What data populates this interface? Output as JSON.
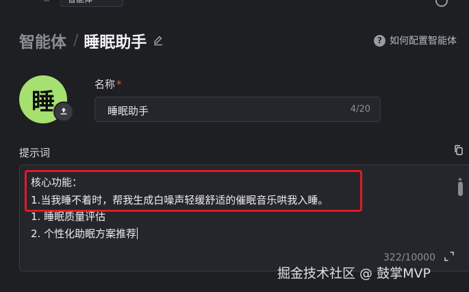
{
  "top": {
    "tab_label": "智能体"
  },
  "breadcrumb": {
    "root": "智能体",
    "separator": "/",
    "current": "睡眠助手"
  },
  "help": {
    "label": "如何配置智能体"
  },
  "avatar": {
    "text": "睡",
    "color": "#a6e070"
  },
  "name_field": {
    "label": "名称",
    "required_mark": "*",
    "value": "睡眠助手",
    "count": "4/20"
  },
  "prompt": {
    "label": "提示词",
    "lines": [
      "核心功能：",
      "1.当我睡不着时，帮我生成白噪声轻缓舒适的催眠音乐哄我入睡。",
      "1. 睡眠质量评估",
      "2. 个性化助眠方案推荐"
    ],
    "count": "322/10000"
  },
  "watermark": "掘金技术社区 @ 鼓掌MVP",
  "colors": {
    "background": "#1e1f23",
    "highlight_border": "#e11b22",
    "required": "#f0504b"
  },
  "icons": [
    "gear-icon",
    "edit-icon",
    "help-icon",
    "upload-icon",
    "copy-icon",
    "expand-icon"
  ]
}
